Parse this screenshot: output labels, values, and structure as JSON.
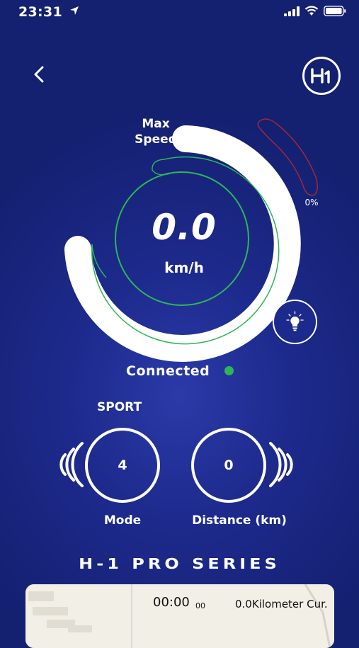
{
  "status_bar": {
    "time": "23:31"
  },
  "header": {
    "logo_text": "H1"
  },
  "gauge": {
    "max_speed_line1": "Max",
    "max_speed_line2": "Speed",
    "speed_value": "0.0",
    "speed_unit": "km/h",
    "battery_percent": "0%"
  },
  "connection": {
    "status_text": "Connected",
    "status_color": "#2cb657"
  },
  "controls": {
    "mode_name": "SPORT",
    "mode_value": "4",
    "mode_label": "Mode",
    "distance_value": "0",
    "distance_label": "Distance (km)"
  },
  "brand": {
    "series_text": "H-1 PRO SERIES"
  },
  "ride_card": {
    "time": "00:00",
    "time_sub": "00",
    "distance_text": "0.0Kilometer Cur."
  },
  "colors": {
    "background": "#1d2a8c",
    "accent_green": "#2cb657",
    "battery_outline": "#9b2a3a"
  }
}
